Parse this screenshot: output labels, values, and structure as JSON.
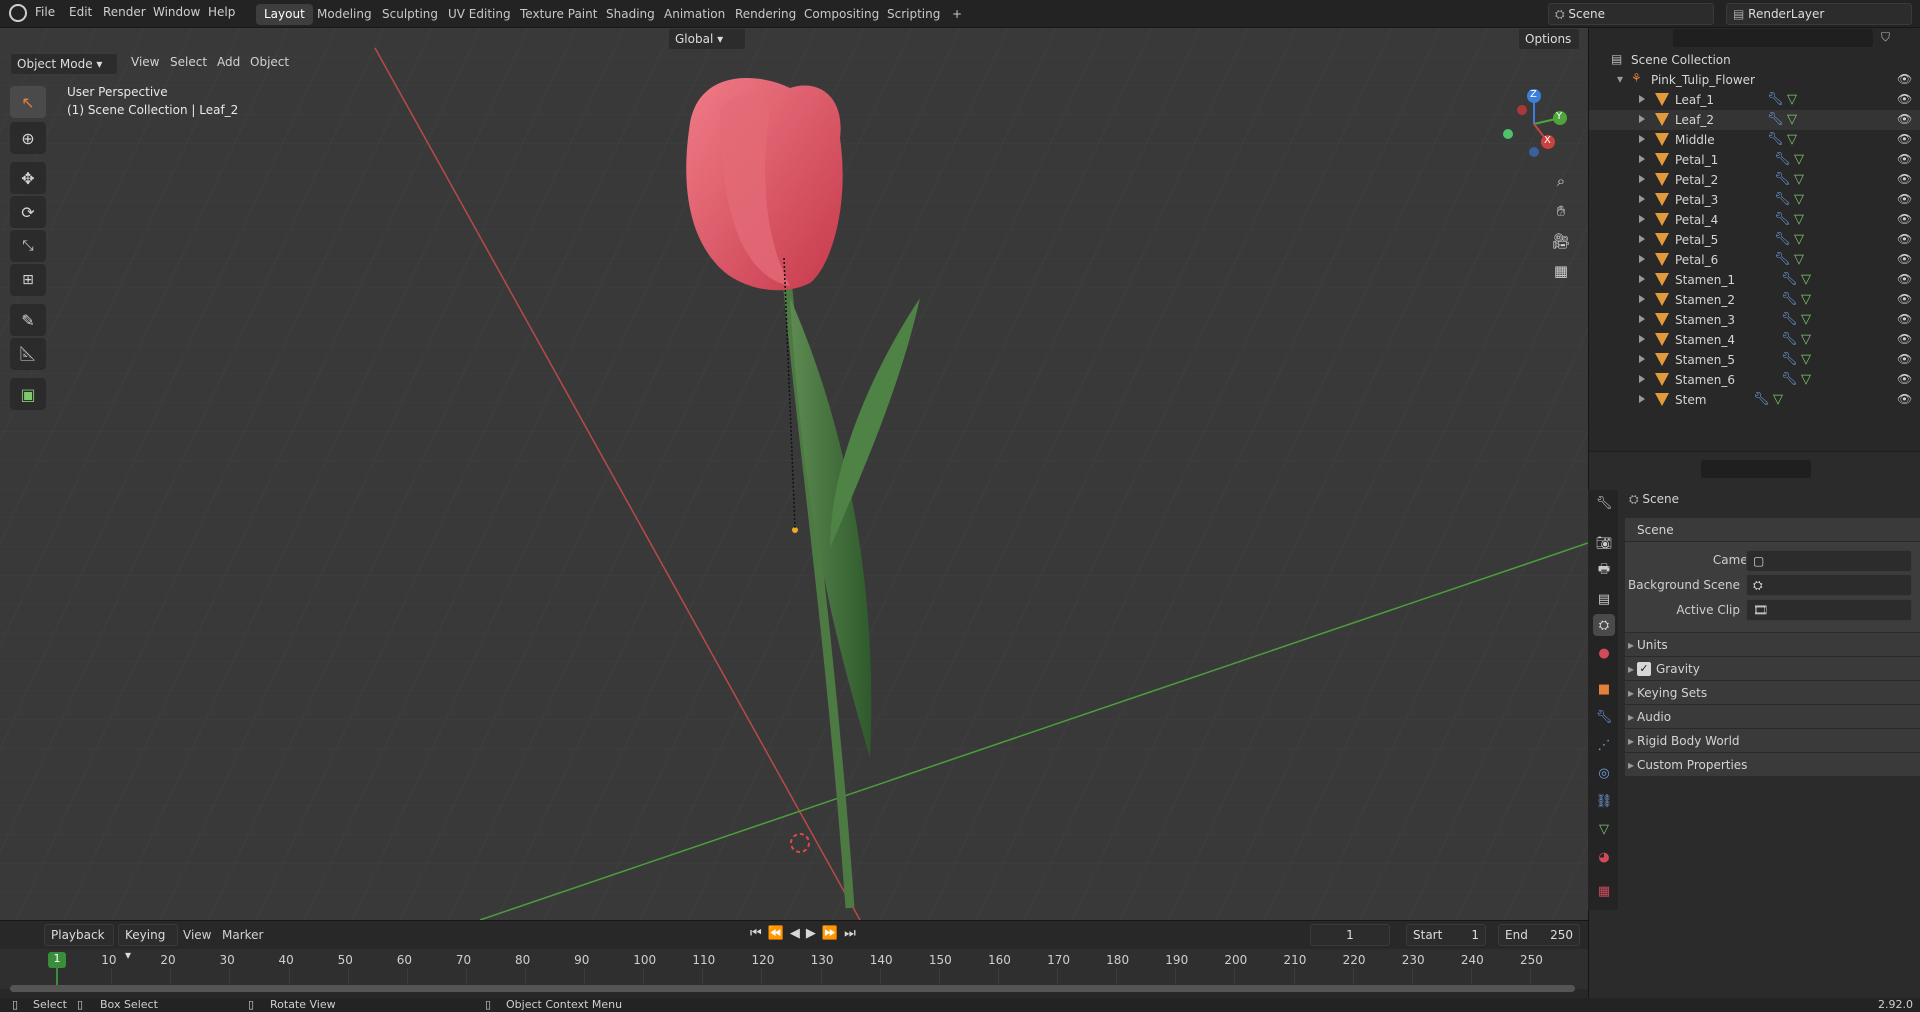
{
  "topbar": {
    "menus": [
      "File",
      "Edit",
      "Render",
      "Window",
      "Help"
    ],
    "workspaces": [
      "Layout",
      "Modeling",
      "Sculpting",
      "UV Editing",
      "Texture Paint",
      "Shading",
      "Animation",
      "Rendering",
      "Compositing",
      "Scripting"
    ],
    "active_workspace": "Layout",
    "add_tab": "+",
    "scene": "Scene",
    "view_layer": "RenderLayer"
  },
  "viewport": {
    "mode": "Object Mode",
    "menus": [
      "View",
      "Select",
      "Add",
      "Object"
    ],
    "transform_orientation": "Global",
    "options_label": "Options",
    "overlay_title": "User Perspective",
    "overlay_sub": "(1) Scene Collection | Leaf_2",
    "gizmo_axes": {
      "x": "X",
      "y": "Y",
      "z": "Z"
    }
  },
  "outliner": {
    "root": "Scene Collection",
    "collection": "Pink_Tulip_Flower",
    "objects": [
      "Leaf_1",
      "Leaf_2",
      "Middle",
      "Petal_1",
      "Petal_2",
      "Petal_3",
      "Petal_4",
      "Petal_5",
      "Petal_6",
      "Stamen_1",
      "Stamen_2",
      "Stamen_3",
      "Stamen_4",
      "Stamen_5",
      "Stamen_6",
      "Stem"
    ],
    "selected": "Leaf_2"
  },
  "properties": {
    "context": "Scene",
    "panel_title": "Scene",
    "camera_label": "Camera",
    "bg_scene_label": "Background Scene",
    "active_clip_label": "Active Clip",
    "subpanels": [
      "Units",
      "Gravity",
      "Keying Sets",
      "Audio",
      "Rigid Body World",
      "Custom Properties"
    ],
    "gravity_checked": true
  },
  "timeline": {
    "menus": [
      "Playback",
      "Keying",
      "View",
      "Marker"
    ],
    "current_frame": "1",
    "start_label": "Start",
    "start": "1",
    "end_label": "End",
    "end": "250",
    "ticks": [
      "10",
      "20",
      "30",
      "40",
      "50",
      "60",
      "70",
      "80",
      "90",
      "100",
      "110",
      "120",
      "130",
      "140",
      "150",
      "160",
      "170",
      "180",
      "190",
      "200",
      "210",
      "220",
      "230",
      "240",
      "250"
    ],
    "playhead_label": "1"
  },
  "status": {
    "select": "Select",
    "box_select": "Box Select",
    "rotate_view": "Rotate View",
    "context_menu": "Object Context Menu",
    "version": "2.92.0"
  },
  "colors": {
    "accent": "#e3813a",
    "x_axis": "#c9423f",
    "y_axis": "#4fa53c",
    "z_axis": "#3a7fd8",
    "tulip": "#e05a6a"
  }
}
